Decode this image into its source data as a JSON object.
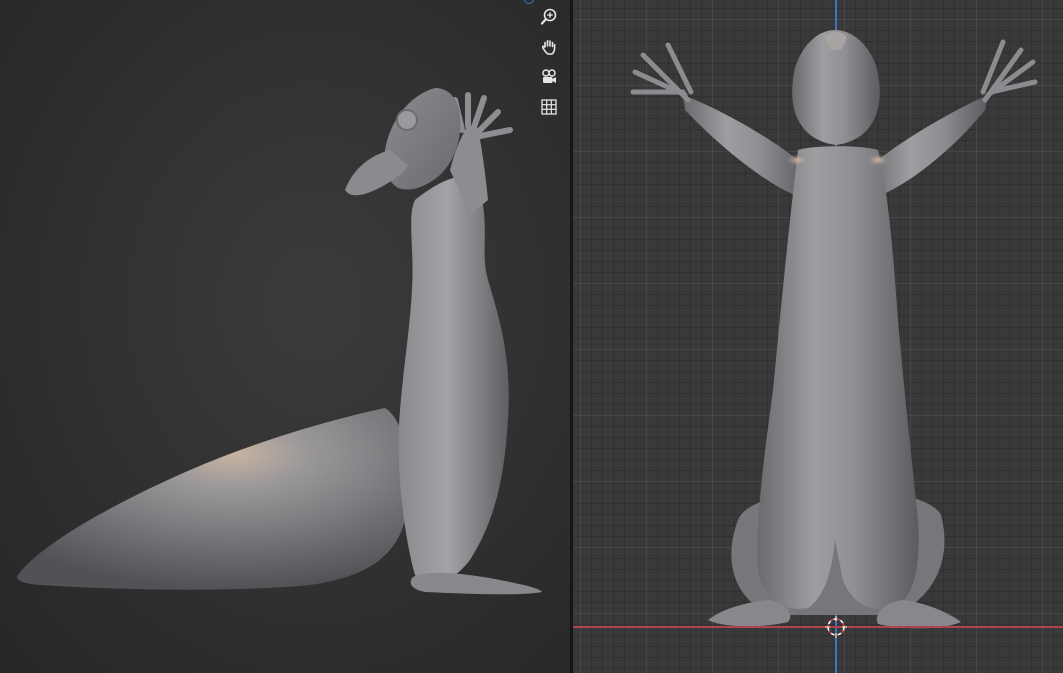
{
  "app": {
    "accent_color": "#3d73bf",
    "x_axis_color": "#b3414d",
    "background_color": "#303030"
  },
  "left_viewport": {
    "view": "perspective",
    "navigation": [
      {
        "icon": "zoom-in-icon"
      },
      {
        "icon": "hand-pan-icon"
      },
      {
        "icon": "camera-icon"
      },
      {
        "icon": "grid-icon"
      }
    ],
    "object": "squirrel-sculpt-side"
  },
  "right_viewport": {
    "view": "orthographic-front",
    "object": "squirrel-sculpt-front",
    "widgets": [
      "3d-cursor-icon"
    ]
  }
}
